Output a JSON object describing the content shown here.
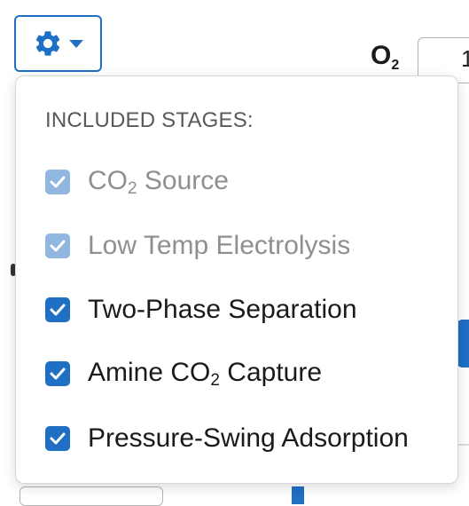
{
  "settings_toggle": {
    "icon": "gear-icon",
    "caret_icon": "caret-down-icon",
    "accent_color": "#1f6fc5"
  },
  "background": {
    "o2_label": "O",
    "o2_sub": "2",
    "o2_value": "1"
  },
  "menu": {
    "header": "INCLUDED STAGES:",
    "stages": [
      {
        "pre": "CO",
        "sub": "2",
        "post": " Source",
        "checked": true,
        "disabled": true
      },
      {
        "pre": "Low Temp Electrolysis",
        "sub": "",
        "post": "",
        "checked": true,
        "disabled": true
      },
      {
        "pre": "Two-Phase Separation",
        "sub": "",
        "post": "",
        "checked": true,
        "disabled": false
      },
      {
        "pre": "Amine CO",
        "sub": "2",
        "post": " Capture",
        "checked": true,
        "disabled": false
      },
      {
        "pre": "Pressure-Swing Adsorption",
        "sub": "",
        "post": "",
        "checked": true,
        "disabled": false
      }
    ]
  },
  "colors": {
    "checkbox_enabled": "#1f6fc5",
    "checkbox_disabled": "#91b7e1",
    "label_disabled": "#8f8f8f"
  }
}
